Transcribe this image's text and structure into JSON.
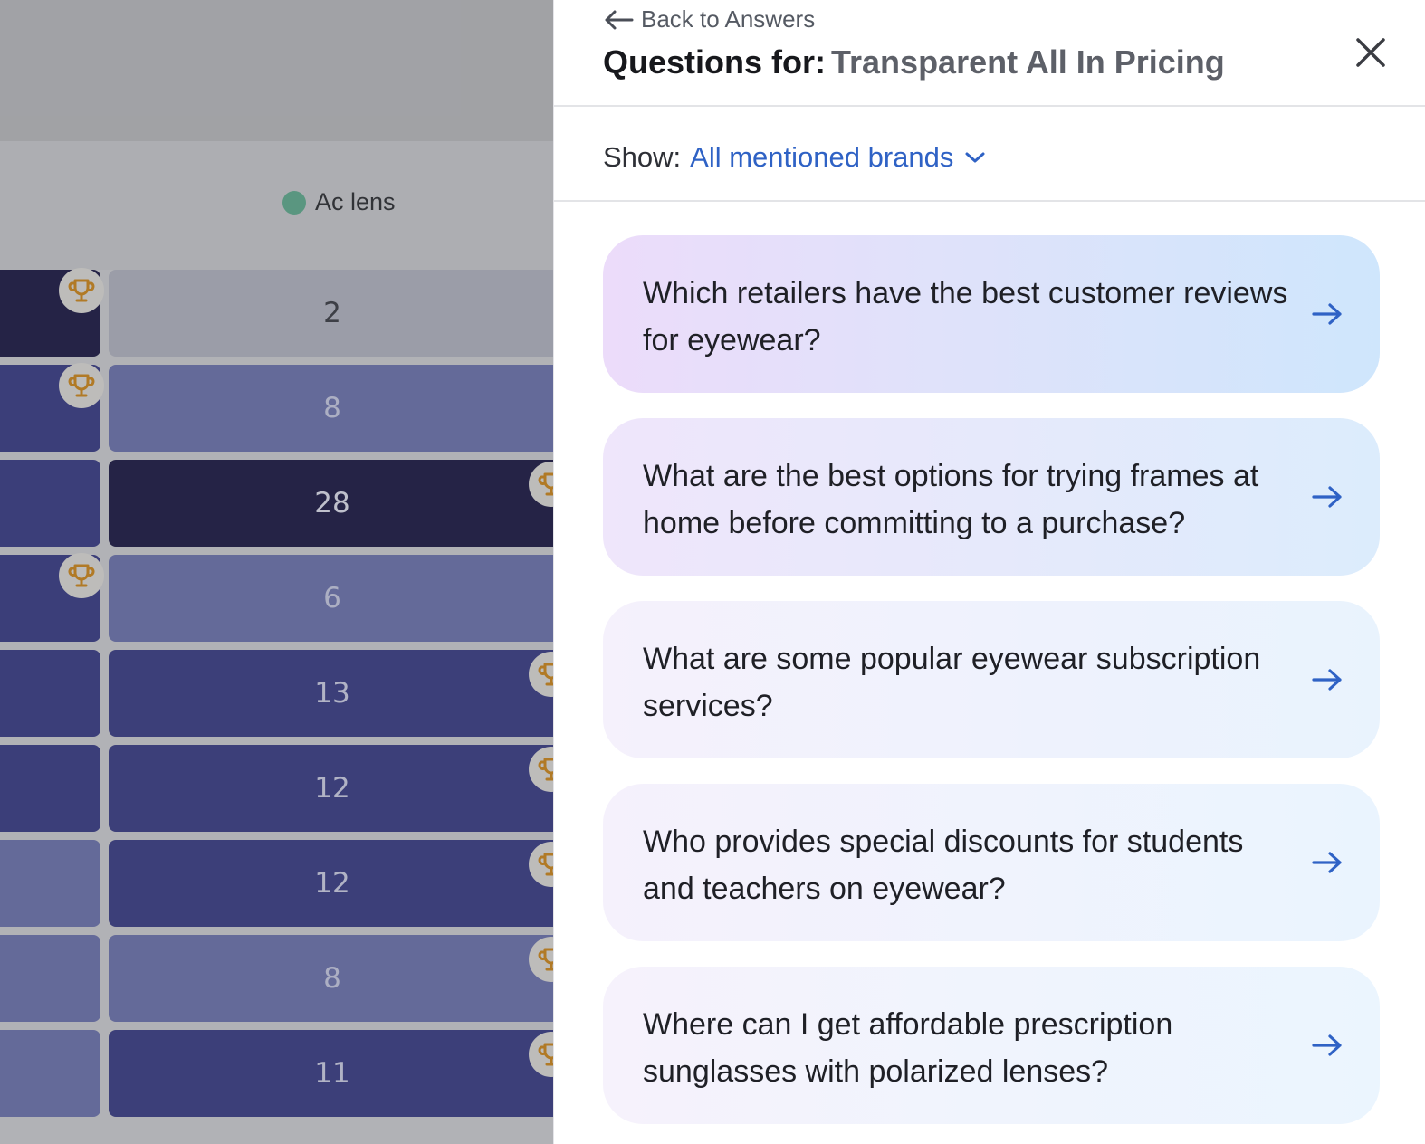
{
  "background_table": {
    "column_brand": {
      "name": "Ac lens",
      "dot_color": "#5fa88c"
    },
    "rows": [
      {
        "value": "2",
        "main_color": "#aeb0bc",
        "text_color": "#3b3d45",
        "left_color": "#1e1b45",
        "trophy": "left"
      },
      {
        "value": "8",
        "main_color": "#6b72aa",
        "text_color": "#c3c6dd",
        "left_color": "#393c83",
        "trophy": "left"
      },
      {
        "value": "28",
        "main_color": "#1e1b45",
        "text_color": "#d9dbe8",
        "left_color": "#393c83",
        "trophy": "right"
      },
      {
        "value": "6",
        "main_color": "#6b72aa",
        "text_color": "#c3c6dd",
        "left_color": "#393c83",
        "trophy": "left"
      },
      {
        "value": "13",
        "main_color": "#3a3d83",
        "text_color": "#c8cbe0",
        "left_color": "#393c83",
        "trophy": "right"
      },
      {
        "value": "12",
        "main_color": "#3a3d83",
        "text_color": "#c8cbe0",
        "left_color": "#393c83",
        "trophy": "right"
      },
      {
        "value": "12",
        "main_color": "#3a3d83",
        "text_color": "#c8cbe0",
        "left_color": "#6b72aa",
        "trophy": "right"
      },
      {
        "value": "8",
        "main_color": "#6b72aa",
        "text_color": "#c3c6dd",
        "left_color": "#6b72aa",
        "trophy": "right"
      },
      {
        "value": "11",
        "main_color": "#3a3d83",
        "text_color": "#c8cbe0",
        "left_color": "#6b72aa",
        "trophy": "right"
      }
    ]
  },
  "panel": {
    "back_label": "Back to Answers",
    "title_prefix": "Questions for:",
    "title_value": "Transparent All In Pricing",
    "show_label": "Show:",
    "show_value": "All mentioned brands",
    "questions": [
      {
        "text": "Which retailers have the best customer reviews for eyewear?"
      },
      {
        "text": "What are the best options for trying frames at home before committing to a purchase?"
      },
      {
        "text": "What are some popular eyewear subscription services?"
      },
      {
        "text": "Who provides special discounts for students and teachers on eyewear?"
      },
      {
        "text": "Where can I get affordable prescription sunglasses with polarized lenses?"
      }
    ]
  },
  "colors": {
    "accent_blue": "#2f62c5",
    "trophy_gold": "#c8861e"
  }
}
